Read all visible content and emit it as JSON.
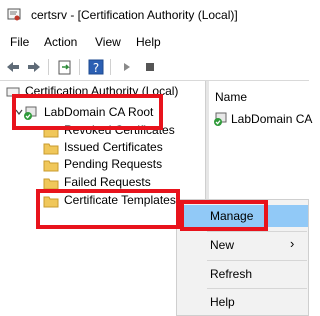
{
  "window": {
    "title": "certsrv - [Certification Authority (Local)]"
  },
  "menubar": {
    "items": [
      "File",
      "Action",
      "View",
      "Help"
    ]
  },
  "toolbar": {
    "buttons": [
      "back-arrow-icon",
      "forward-arrow-icon",
      "export-icon",
      "help-icon",
      "play-icon",
      "stop-icon"
    ]
  },
  "tree": {
    "root": "Certification Authority (Local)",
    "ca": "LabDomain CA Root",
    "folders": [
      "Revoked Certificates",
      "Issued Certificates",
      "Pending Requests",
      "Failed Requests",
      "Certificate Templates"
    ]
  },
  "right_pane": {
    "column_header": "Name",
    "item": "LabDomain CA"
  },
  "context_menu": {
    "items": [
      "Manage",
      "New",
      "Refresh",
      "Help"
    ],
    "submenu_arrow": "›"
  },
  "colors": {
    "highlight_box": "#e8131c",
    "menu_hover": "#91c9f7",
    "folder_yellow": "#f0c75a"
  }
}
